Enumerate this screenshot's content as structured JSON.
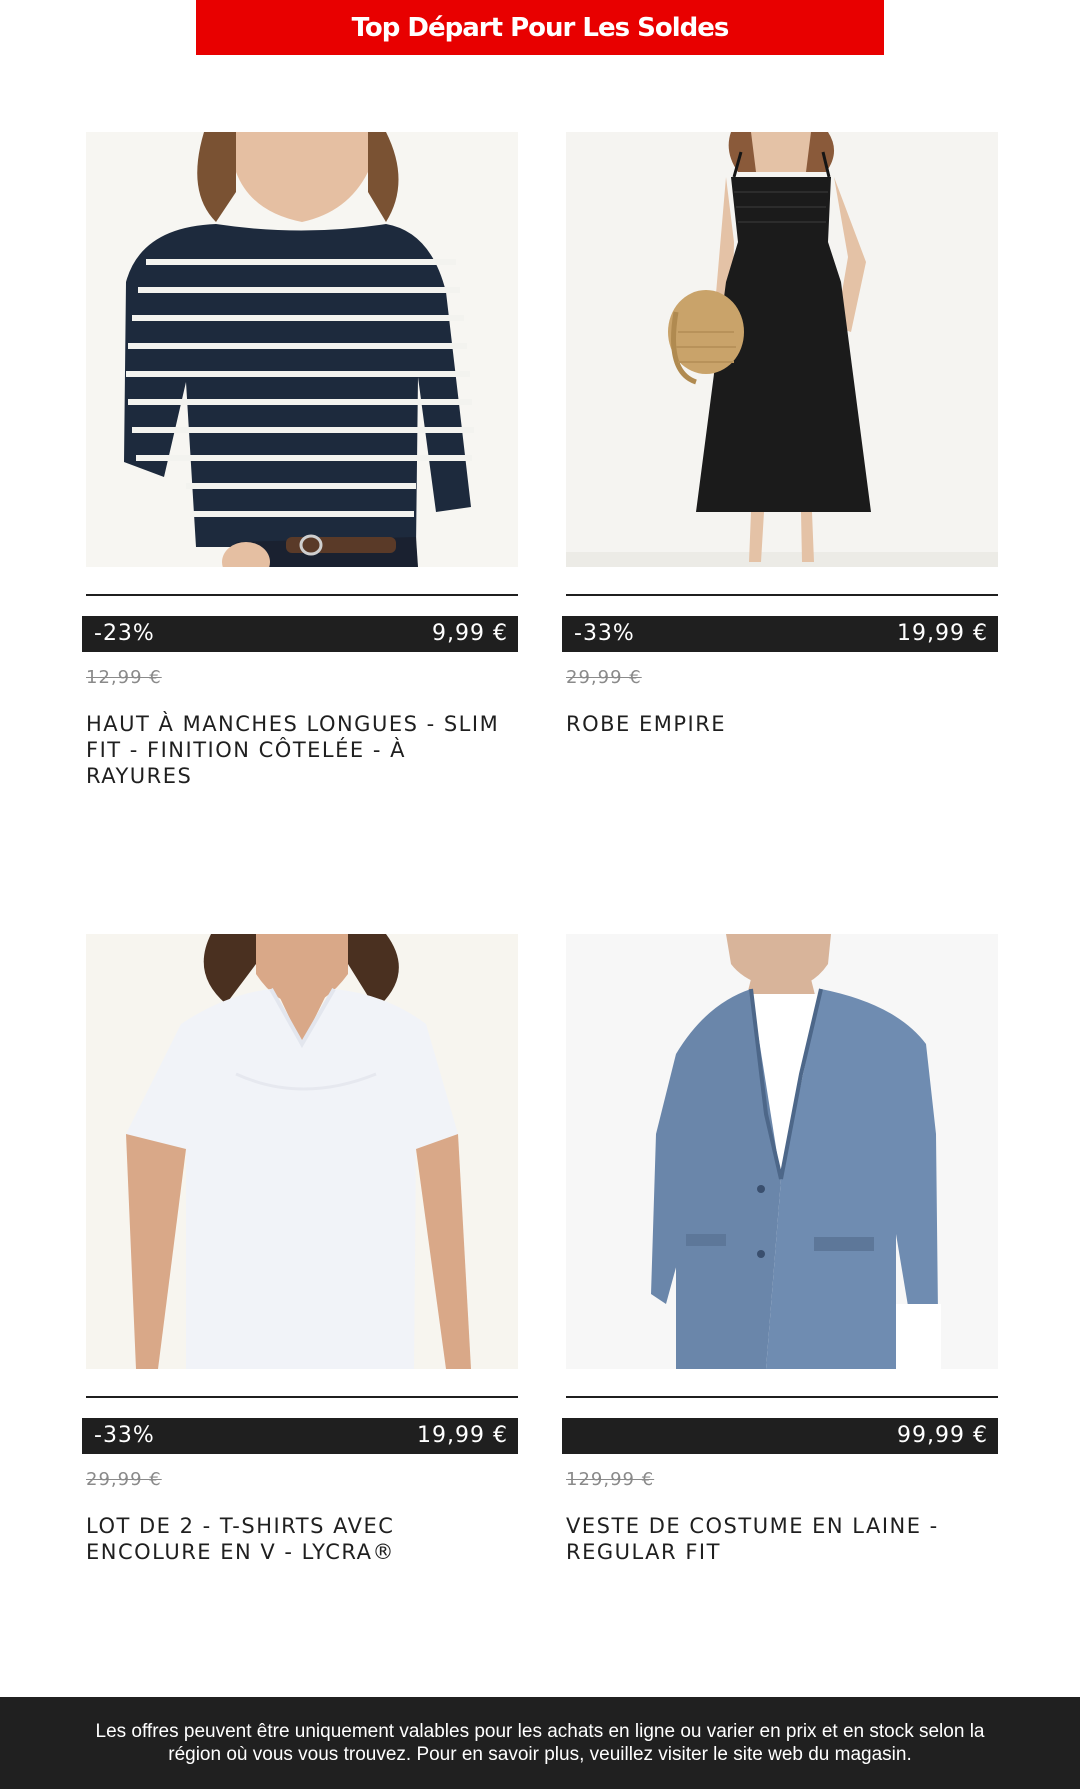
{
  "banner": {
    "title": "Top Départ Pour Les Soldes",
    "color": "#e80000"
  },
  "products": [
    {
      "image_alt": "Femme portant un haut marine à rayures blanches",
      "discount": "-23%",
      "price": "9,99 €",
      "old_price": "12,99 €",
      "name": "HAUT À MANCHES LONGUES - SLIM FIT - FINITION CÔTELÉE - À RAYURES"
    },
    {
      "image_alt": "Femme portant une robe noire à bretelles avec un sac en paille",
      "discount": "-33%",
      "price": "19,99 €",
      "old_price": "29,99 €",
      "name": "ROBE EMPIRE"
    },
    {
      "image_alt": "Femme portant un t-shirt blanc à col V",
      "discount": "-33%",
      "price": "19,99 €",
      "old_price": "29,99 €",
      "name": "LOT DE 2 - T-SHIRTS AVEC ENCOLURE EN V - LYCRA®"
    },
    {
      "image_alt": "Homme portant une veste de costume bleu chiné",
      "discount": "",
      "price": "99,99 €",
      "old_price": "129,99 €",
      "name": "VESTE DE COSTUME EN LAINE - REGULAR FIT"
    }
  ],
  "footer": {
    "text": "Les offres peuvent être uniquement valables pour les achats en ligne ou varier en prix et en stock selon la région où vous vous trouvez. Pour en savoir plus, veuillez visiter le site web du magasin."
  },
  "colors": {
    "bar": "#1f1f1f",
    "accent": "#e80000",
    "strike": "#8a8a8a"
  }
}
